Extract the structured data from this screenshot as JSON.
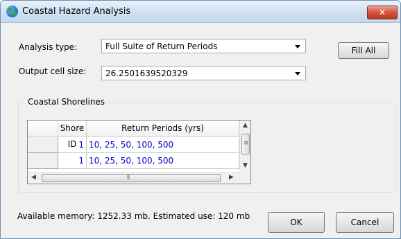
{
  "window": {
    "title": "Coastal Hazard Analysis",
    "close_label": "✕"
  },
  "form": {
    "analysis_type_label": "Analysis type:",
    "analysis_type_value": "Full Suite of Return Periods",
    "output_cell_size_label": "Output cell size:",
    "output_cell_size_value": "26.2501639520329",
    "fill_all_label": "Fill All"
  },
  "shorelines": {
    "group_label": "Coastal Shorelines",
    "columns": [
      "Shore ID",
      "Return Periods (yrs)"
    ],
    "rows": [
      {
        "shore_id": "1",
        "return_periods": "10, 25, 50, 100, 500"
      },
      {
        "shore_id": "1",
        "return_periods": "10, 25, 50, 100, 500"
      }
    ]
  },
  "footer": {
    "status": "Available memory: 1252.33 mb. Estimated use: 120 mb",
    "ok_label": "OK",
    "cancel_label": "Cancel"
  },
  "icons": {
    "app": "globe-icon",
    "close": "close-icon",
    "dropdown": "chevron-down-icon",
    "scroll_up": "arrow-up-icon",
    "scroll_down": "arrow-down-icon",
    "scroll_left": "arrow-left-icon",
    "scroll_right": "arrow-right-icon"
  },
  "colors": {
    "title_bar": "#cfe0f2",
    "close_button": "#d5533b",
    "cell_text": "#0000cc",
    "dialog_bg": "#f0f0f0"
  }
}
